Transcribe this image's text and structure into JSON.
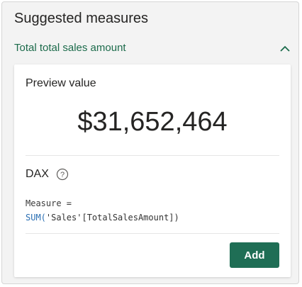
{
  "panel": {
    "title": "Suggested measures",
    "section_title": "Total total sales amount",
    "collapse_icon": "chevron-up-icon"
  },
  "card": {
    "preview_label": "Preview value",
    "preview_value": "$31,652,464",
    "dax_label": "DAX",
    "help_icon": "help-circle-icon",
    "code_line1": "Measure =",
    "code_fn": "SUM(",
    "code_arg": "'Sales'[TotalSalesAmount]",
    "code_close": ")",
    "add_label": "Add"
  },
  "colors": {
    "accent_text": "#1c6b4b",
    "button": "#1f6e55",
    "function": "#2a6fb3"
  }
}
